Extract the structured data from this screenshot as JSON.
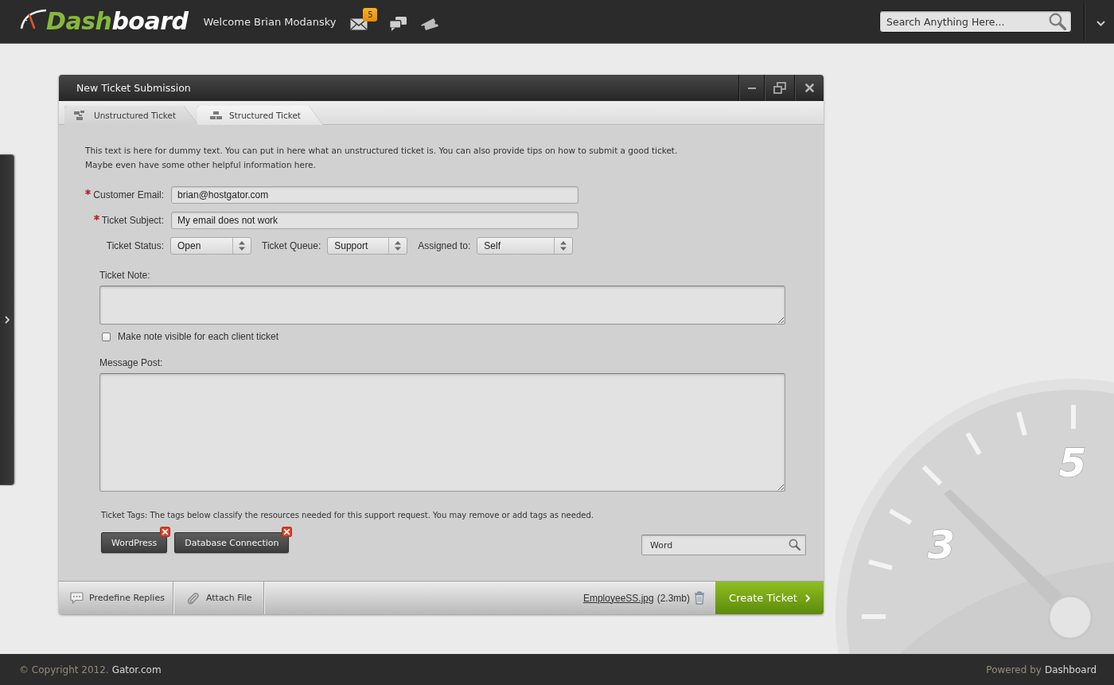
{
  "topbar": {
    "logo": {
      "accent": "Dash",
      "rest": "board"
    },
    "welcome": "Welcome Brian Modansky",
    "icons": [
      {
        "kind": "mail",
        "badge": "5"
      },
      {
        "kind": "chat"
      },
      {
        "kind": "ticket"
      }
    ],
    "search": {
      "placeholder": "Search Anything Here..."
    }
  },
  "side_drawer": {
    "expanded": false
  },
  "window": {
    "title": "New Ticket Submission",
    "controls": [
      {
        "kind": "minimize"
      },
      {
        "kind": "restore"
      },
      {
        "kind": "close"
      }
    ]
  },
  "tabs": [
    {
      "label": "Unstructured Ticket",
      "kind": "unstructured",
      "selected": true
    },
    {
      "label": "Structured Ticket",
      "kind": "structured",
      "selected": false
    }
  ],
  "intro_lines": [
    "This text is here for dummy text. You can put in here what an unstructured ticket is. You can also provide tips on how to submit a good ticket.",
    "Maybe even have some other helpful information here."
  ],
  "fields": [
    {
      "label": "Customer Email:",
      "required": true,
      "value": "brian@hostgator.com"
    },
    {
      "label": "Ticket Subject:",
      "required": true,
      "value": "My email does not work"
    }
  ],
  "selects": [
    {
      "label": "Ticket Status:",
      "value": "Open"
    },
    {
      "label": "Ticket Queue:",
      "value": "Support"
    },
    {
      "label": "Assigned to:",
      "value": "Self"
    }
  ],
  "note": {
    "label": "Ticket Note:",
    "visible_option": {
      "label": "Make note visible for each client ticket",
      "checked": false
    }
  },
  "message": {
    "label": "Message Post:"
  },
  "tags": {
    "hint": "Ticket Tags: The tags below classify the resources needed for this support request. You may remove or add tags as needed.",
    "items": [
      {
        "label": "WordPress"
      },
      {
        "label": "Database Connection"
      }
    ],
    "search": {
      "value": "Word"
    }
  },
  "bottom_bar": {
    "actions": [
      {
        "kind": "replies",
        "label": "Predefine Replies"
      },
      {
        "kind": "attach",
        "label": "Attach File"
      }
    ],
    "attachment": {
      "name": "EmployeeSS.jpg",
      "size": "(2.3mb)"
    },
    "submit": {
      "label": "Create Ticket"
    }
  },
  "background_gauge": {
    "numerals": [
      "3",
      "5"
    ]
  },
  "footer": {
    "copyright": "© Copyright 2012.",
    "site": "Gator.com",
    "powered_label": "Powered by",
    "powered_name": "Dashboard"
  }
}
